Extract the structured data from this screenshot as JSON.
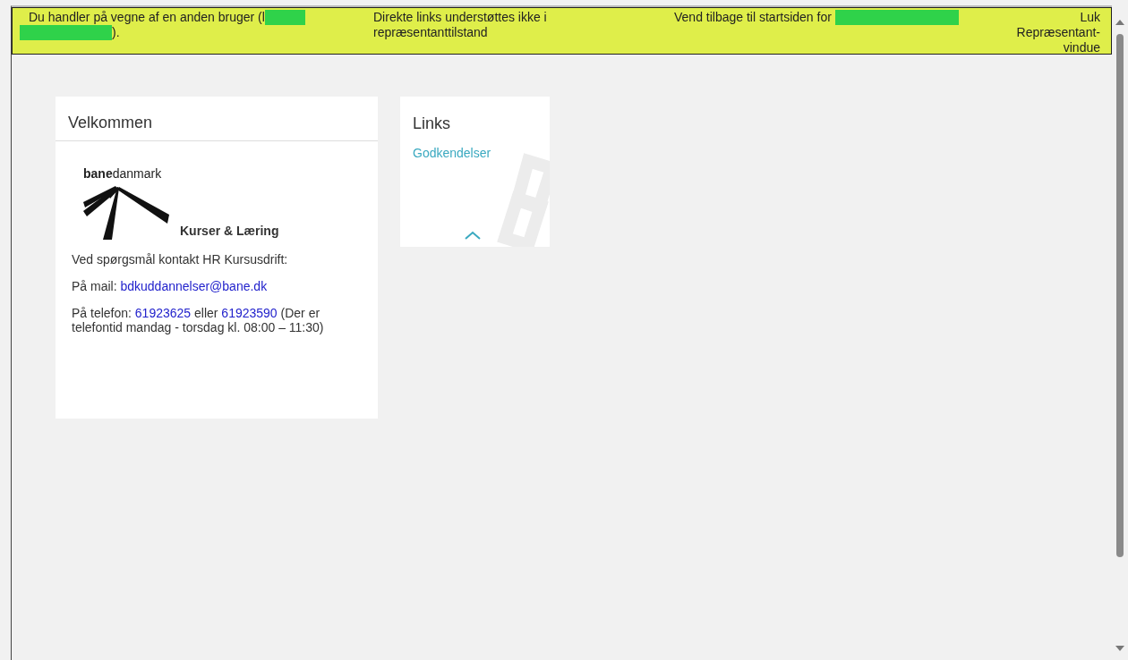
{
  "banner": {
    "acting_as": "Du handler på vegne af en anden bruger (l",
    "acting_as_end": ").",
    "notice": "Direkte links understøttes ikke i repræsentanttilstand",
    "return": "Vend tilbage til startsiden for",
    "close": "Luk Repræsentant-vindue"
  },
  "welcome": {
    "title": "Velkommen",
    "logo_text": "**bane**danmark",
    "subtitle": "Kurser & Læring",
    "paragraphs": [
      [
        {
          "kind": "text",
          "text": "Ved spørgsmål kontakt HR Kursusdrift:"
        }
      ],
      [
        {
          "kind": "text",
          "text": "På mail: "
        },
        {
          "kind": "link",
          "text": "bdkuddannelser@bane.dk"
        }
      ],
      [
        {
          "kind": "text",
          "text": "På telefon: "
        },
        {
          "kind": "link",
          "text": "61923625"
        },
        {
          "kind": "text",
          "text": " eller "
        },
        {
          "kind": "link",
          "text": "61923590"
        },
        {
          "kind": "text",
          "text": " (Der er telefontid mandag - torsdag kl. 08:00 – 11:30)"
        }
      ]
    ]
  },
  "links": {
    "title": "Links",
    "items": [
      "Godkendelser"
    ]
  }
}
